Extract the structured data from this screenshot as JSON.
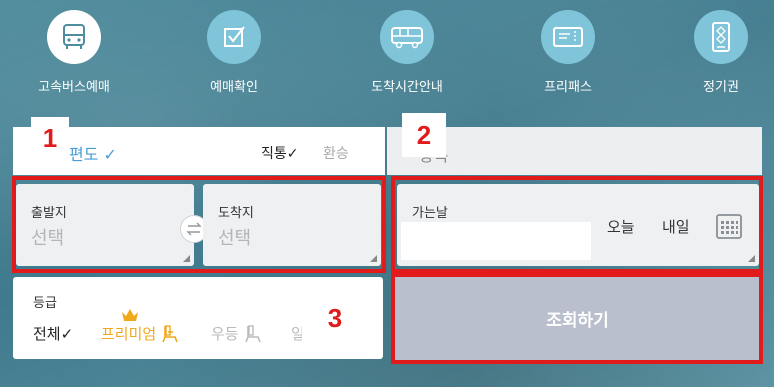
{
  "nav": {
    "items": [
      {
        "label": "고속버스예매",
        "icon": "bus-icon",
        "active": true
      },
      {
        "label": "예매확인",
        "icon": "checkbox-icon",
        "active": false
      },
      {
        "label": "도착시간안내",
        "icon": "bus-clock-icon",
        "active": false
      },
      {
        "label": "프리패스",
        "icon": "ticket-icon",
        "active": false
      },
      {
        "label": "정기권",
        "icon": "pass-card-icon",
        "active": false
      }
    ]
  },
  "trip": {
    "oneway_label": "편도 ✓",
    "direct_label": "직통✓",
    "transfer_label": "환승",
    "round_label": "왕복"
  },
  "route": {
    "departure_label": "출발지",
    "departure_value": "선택",
    "arrival_label": "도착지",
    "arrival_value": "선택"
  },
  "date": {
    "label": "가는날",
    "value": "",
    "today_label": "오늘",
    "tomorrow_label": "내일"
  },
  "grade": {
    "label": "등급",
    "all_label": "전체✓",
    "premium_label": "프리미엄",
    "woodeung_label": "우등",
    "ilban_label": "일"
  },
  "search_button": "조회하기",
  "annotations": {
    "tag1": "1",
    "tag2": "2",
    "tag3": "3"
  },
  "colors": {
    "annotation_red": "#e11b1b",
    "accent_blue": "#4a9ed6",
    "premium_gold": "#f0a81c",
    "search_button_bg": "#b9bfcc"
  }
}
